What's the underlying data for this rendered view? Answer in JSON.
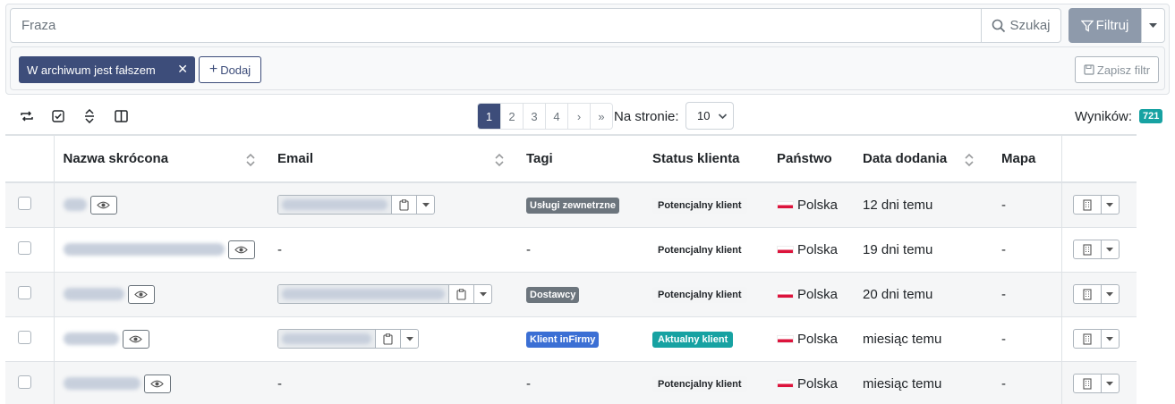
{
  "search": {
    "placeholder": "Fraza",
    "search_button": "Szukaj",
    "filter_button": "Filtruj"
  },
  "filters": {
    "active_chip": "W archiwum jest fałszem",
    "add_button": "Dodaj",
    "save_button": "Zapisz filtr"
  },
  "pagination": {
    "pages": [
      "1",
      "2",
      "3",
      "4"
    ],
    "current": "1",
    "next": "›",
    "last": "»",
    "per_page_label": "Na stronie:",
    "per_page_value": "10"
  },
  "results": {
    "label": "Wyników:",
    "count": "721"
  },
  "table": {
    "headers": {
      "name": "Nazwa skrócona",
      "email": "Email",
      "tags": "Tagi",
      "status": "Status klienta",
      "country": "Państwo",
      "date": "Data dodania",
      "map": "Mapa"
    },
    "rows": [
      {
        "email": "hidden",
        "tag": "Usługi zewnetrzne",
        "tag_color": "#6c757d",
        "status": "Potencjalny klient",
        "status_active": false,
        "country": "Polska",
        "date": "12 dni temu",
        "map": "-"
      },
      {
        "email": "-",
        "tag": "-",
        "tag_color": "",
        "status": "Potencjalny klient",
        "status_active": false,
        "country": "Polska",
        "date": "19 dni temu",
        "map": "-"
      },
      {
        "email": "hidden",
        "tag": "Dostawcy",
        "tag_color": "#6c757d",
        "status": "Potencjalny klient",
        "status_active": false,
        "country": "Polska",
        "date": "20 dni temu",
        "map": "-"
      },
      {
        "email": "hidden",
        "tag": "Klient inFirmy",
        "tag_color": "#3b6fd4",
        "status": "Aktualny klient",
        "status_active": true,
        "country": "Polska",
        "date": "miesiąc temu",
        "map": "-"
      },
      {
        "email": "-",
        "tag": "-",
        "tag_color": "",
        "status": "Potencjalny klient",
        "status_active": false,
        "country": "Polska",
        "date": "miesiąc temu",
        "map": "-"
      }
    ]
  },
  "colors": {
    "primary": "#3d4d7a",
    "filter_button": "#8e9aab",
    "results_badge": "#17a2a2",
    "tag_blue": "#3b6fd4",
    "flag_red": "#dc143c"
  }
}
